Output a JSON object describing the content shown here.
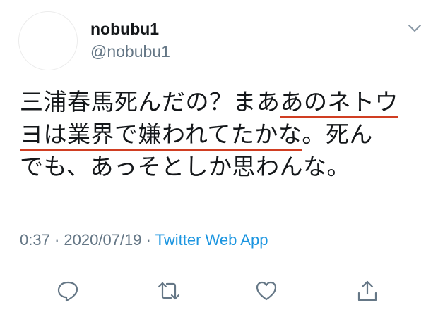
{
  "user": {
    "display_name": "nobubu1",
    "handle": "@nobubu1"
  },
  "tweet": {
    "line1_a": "三浦春馬死んだの？まあ",
    "line1_b": "あのネトウ",
    "line2_a": "ヨは業界で嫌われてたかな",
    "line2_b": "。死ん",
    "line3": "でも、あっそとしか思わんな。"
  },
  "meta": {
    "time": "0:37",
    "sep1": " · ",
    "date": "2020/07/19",
    "sep2": " · ",
    "source": "Twitter Web App"
  },
  "colors": {
    "text": "#14171a",
    "secondary": "#657786",
    "link": "#1b95e0",
    "underline": "#d03e22"
  },
  "icons": {
    "reply": "reply-icon",
    "retweet": "retweet-icon",
    "like": "heart-icon",
    "share": "share-icon",
    "caret": "chevron-down-icon"
  }
}
